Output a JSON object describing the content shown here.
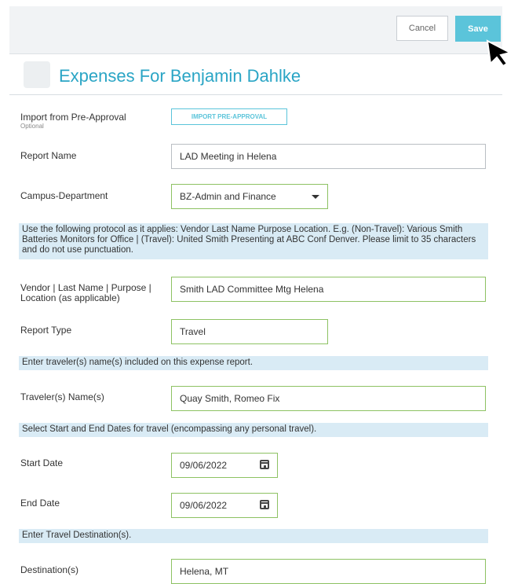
{
  "toolbar": {
    "cancel_label": "Cancel",
    "save_label": "Save"
  },
  "page": {
    "title": "Expenses For Benjamin Dahlke"
  },
  "import": {
    "label": "Import from Pre-Approval",
    "sub": "Optional",
    "button": "IMPORT PRE-APPROVAL"
  },
  "report_name": {
    "label": "Report Name",
    "value": "LAD Meeting in Helena"
  },
  "campus": {
    "label": "Campus-Department",
    "value": "BZ-Admin and Finance"
  },
  "protocol_note": "Use the following protocol as it applies: Vendor Last Name Purpose Location. E.g. (Non-Travel): Various Smith Batteries Monitors for Office | (Travel): United Smith Presenting at ABC Conf Denver. Please limit to 35 characters and do not use punctuation.",
  "vendor": {
    "label": "Vendor | Last Name | Purpose | Location (as applicable)",
    "value": "Smith LAD Committee Mtg Helena"
  },
  "report_type": {
    "label": "Report Type",
    "value": "Travel"
  },
  "traveler_note": "Enter traveler(s) name(s) included on this expense report.",
  "travelers": {
    "label": "Traveler(s) Name(s)",
    "value": "Quay Smith, Romeo Fix"
  },
  "dates_note": "Select Start and End Dates for travel (encompassing any personal travel).",
  "start_date": {
    "label": "Start Date",
    "value": "09/06/2022"
  },
  "end_date": {
    "label": "End Date",
    "value": "09/06/2022"
  },
  "destination_note": "Enter Travel Destination(s).",
  "destination": {
    "label": "Destination(s)",
    "value": "Helena, MT"
  }
}
